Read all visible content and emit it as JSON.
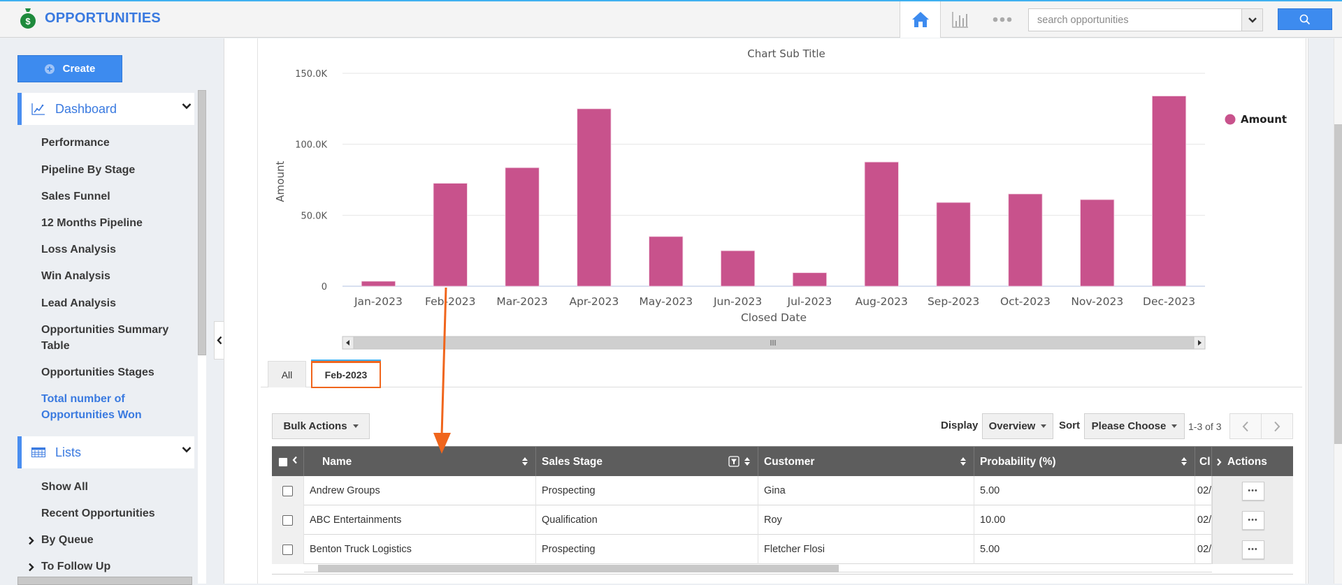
{
  "header": {
    "app_title": "OPPORTUNITIES",
    "logo_icon": "money-bag-icon",
    "nav": [
      {
        "name": "home",
        "icon": "home-icon",
        "active": true
      },
      {
        "name": "reports",
        "icon": "bar-chart-icon",
        "active": false
      },
      {
        "name": "more",
        "icon": "more-dots-icon",
        "active": false
      }
    ],
    "search": {
      "placeholder": "search opportunities",
      "value": ""
    },
    "colors": {
      "accent": "#3d8bef",
      "title": "#3a7ae0",
      "logo": "#1e8a3c"
    }
  },
  "sidebar": {
    "create_label": "Create",
    "sections": [
      {
        "title": "Dashboard",
        "icon": "line-chart-icon",
        "expanded": true,
        "items": [
          {
            "label": "Performance",
            "active": false
          },
          {
            "label": "Pipeline By Stage",
            "active": false
          },
          {
            "label": "Sales Funnel",
            "active": false
          },
          {
            "label": "12 Months Pipeline",
            "active": false
          },
          {
            "label": "Loss Analysis",
            "active": false
          },
          {
            "label": "Win Analysis",
            "active": false
          },
          {
            "label": "Lead Analysis",
            "active": false
          },
          {
            "label_line1": "Opportunities Summary",
            "label_line2": "Table",
            "active": false
          },
          {
            "label": "Opportunities Stages",
            "active": false
          },
          {
            "label_line1": "Total number of",
            "label_line2": "Opportunities Won",
            "active": true
          }
        ]
      },
      {
        "title": "Lists",
        "icon": "calendar-grid-icon",
        "expanded": true,
        "items": [
          {
            "label": "Show All",
            "has_children": false
          },
          {
            "label": "Recent Opportunities",
            "has_children": false
          },
          {
            "label": "By Queue",
            "has_children": true
          },
          {
            "label": "To Follow Up",
            "has_children": true
          }
        ]
      }
    ]
  },
  "chart_data": {
    "type": "bar",
    "title": "",
    "subtitle": "Chart Sub Title",
    "xlabel": "Closed Date",
    "ylabel": "Amount",
    "categories": [
      "Jan-2023",
      "Feb-2023",
      "Mar-2023",
      "Apr-2023",
      "May-2023",
      "Jun-2023",
      "Jul-2023",
      "Aug-2023",
      "Sep-2023",
      "Oct-2023",
      "Nov-2023",
      "Dec-2023"
    ],
    "series": [
      {
        "name": "Amount",
        "color": "#c8528c",
        "values": [
          3500,
          72500,
          83500,
          125000,
          35000,
          25000,
          9500,
          87500,
          59000,
          65000,
          61000,
          134000
        ]
      }
    ],
    "yticks": [
      0,
      50000,
      100000,
      150000
    ],
    "ytick_labels": [
      "0",
      "50.0K",
      "100.0K",
      "150.0K"
    ],
    "ylim": [
      0,
      150000
    ],
    "grid": true,
    "legend": {
      "position": "right",
      "entries": [
        "Amount"
      ]
    }
  },
  "tabs": [
    {
      "label": "All",
      "active": false
    },
    {
      "label": "Feb-2023",
      "active": true
    }
  ],
  "toolbar": {
    "bulk_actions": "Bulk Actions",
    "display_label": "Display",
    "display_value": "Overview",
    "sort_label": "Sort",
    "sort_value": "Please Choose",
    "range": "1-3 of 3"
  },
  "table": {
    "columns": [
      "Name",
      "Sales Stage",
      "Customer",
      "Probability (%)",
      "Cl",
      "Actions"
    ],
    "rows": [
      {
        "name": "Andrew Groups",
        "stage": "Prospecting",
        "customer": "Gina",
        "probability": "5.00",
        "closed": "02/"
      },
      {
        "name": "ABC Entertainments",
        "stage": "Qualification",
        "customer": "Roy",
        "probability": "10.00",
        "closed": "02/"
      },
      {
        "name": "Benton Truck Logistics",
        "stage": "Prospecting",
        "customer": "Fletcher Flosi",
        "probability": "5.00",
        "closed": "02/"
      }
    ],
    "row_action_label": "•••"
  },
  "annotation": {
    "color": "#f0651c"
  }
}
